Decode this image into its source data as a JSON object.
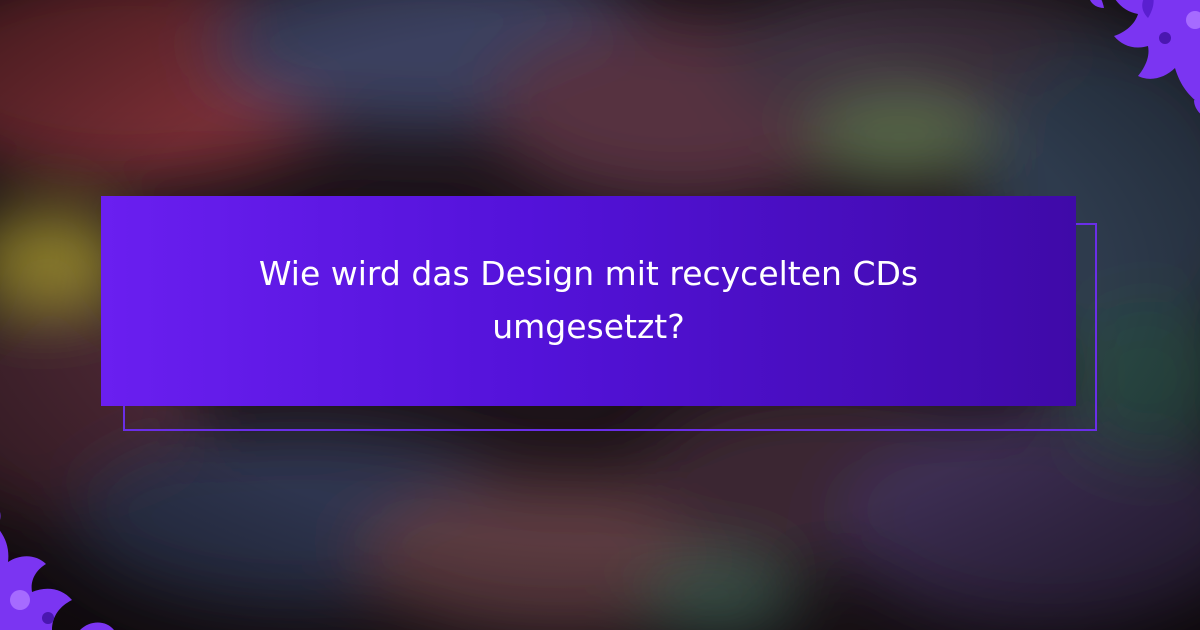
{
  "card": {
    "title": "Wie wird das Design mit recycelten CDs umgesetzt?"
  },
  "colors": {
    "card_left": "#6a1ff0",
    "card_right": "#3f0aa8",
    "outline": "#6a2ee8",
    "ornament": "#7b35f2",
    "text": "#ffffff"
  },
  "icons": {
    "top_right": "floral-ornament-icon",
    "bottom_left": "floral-ornament-icon"
  }
}
